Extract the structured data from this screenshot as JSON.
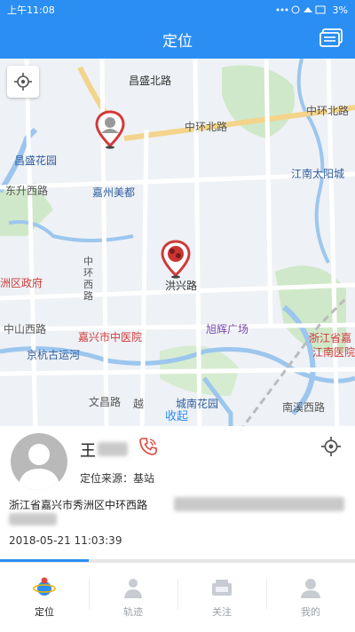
{
  "status_bar": {
    "time": "上午11:08",
    "battery": "3%"
  },
  "header": {
    "title": "定位",
    "message_icon": "message-list-icon"
  },
  "map": {
    "labels": {
      "changsheng_north": "昌盛北路",
      "zhonghuan_road": "中环北路",
      "zhonghuan_north": "中环北路",
      "jiangnan_taiyangcheng": "江南太阳城",
      "changsheng_garden": "昌盛花园",
      "dongsheng_west": "东升西路",
      "jiazhou_meidu": "嘉州美都",
      "xiuzhou_govt": "洲区政府",
      "zhonghuan_west": "中环西路",
      "hongxing_road": "洪兴路",
      "xuhui_plaza": "旭辉广场",
      "zhongshan_west": "中山西路",
      "jiaxing_tcm": "嘉兴市中医院",
      "jingkang_canal": "京杭古运河",
      "zhejiang_hospital": "浙江省嘉",
      "zhejiang_hospital2": "江南医院",
      "wenchang_road": "文昌路",
      "nanxi_road": "南溪西路",
      "yue_road": "越",
      "hubin_garden": "城南花园"
    }
  },
  "panel": {
    "collapse_label": "收起",
    "name": "王",
    "source": "定位来源：基站",
    "address": "浙江省嘉兴市秀洲区中环西路",
    "timestamp": "2018-05-21 11:03:39",
    "progress": 0.25
  },
  "tabs": [
    {
      "label": "定位",
      "icon": "location-globe-icon",
      "active": true
    },
    {
      "label": "轨迹",
      "icon": "track-person-icon",
      "active": false
    },
    {
      "label": "关注",
      "icon": "follow-icon",
      "active": false
    },
    {
      "label": "我的",
      "icon": "profile-icon",
      "active": false
    }
  ],
  "colors": {
    "accent": "#2b8ef3",
    "pin": "#d03a3a"
  }
}
